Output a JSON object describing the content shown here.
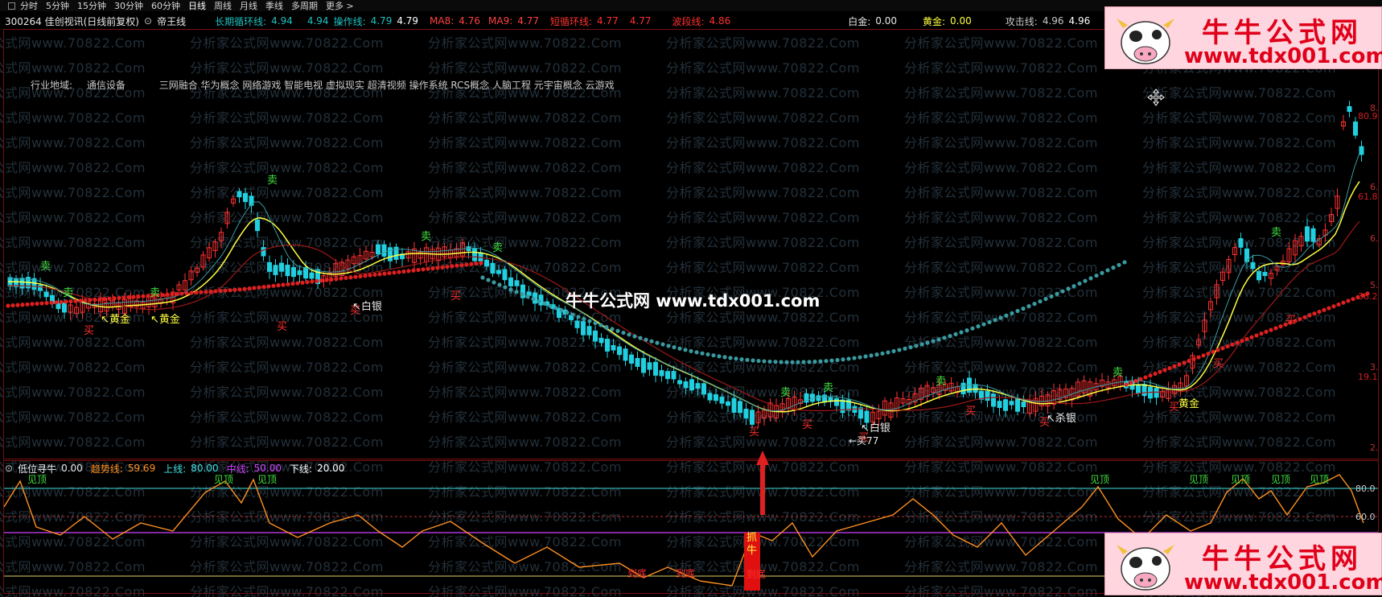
{
  "toolbar": {
    "tabs": [
      "分时",
      "5分钟",
      "15分钟",
      "30分钟",
      "60分钟",
      "日线",
      "周线",
      "月线",
      "季线",
      "多周期",
      "更多 >"
    ],
    "active_tab": "日线"
  },
  "stock": {
    "code_name": "300264 佳创视讯(日线前复权)",
    "indicator_name": "帝王线"
  },
  "main_indicators": [
    {
      "label": "长期循环线:",
      "value": "4.94",
      "color": "#20c0c0"
    },
    {
      "label": "",
      "value": "4.94",
      "color": "#20c0c0"
    },
    {
      "label": "操作线:",
      "value": "4.79",
      "color": "#20c0c0"
    },
    {
      "label": "",
      "value": "4.79",
      "color": "#ffffff"
    },
    {
      "label": "MA8:",
      "value": "4.76",
      "color": "#ff4040"
    },
    {
      "label": "MA9:",
      "value": "4.77",
      "color": "#ff4040"
    },
    {
      "label": "短循环线:",
      "value": "4.77",
      "color": "#ff3030"
    },
    {
      "label": "",
      "value": "4.77",
      "color": "#ff3030"
    },
    {
      "label": "波段线:",
      "value": "4.86",
      "color": "#ff3030"
    },
    {
      "label": "白金:",
      "value": "0.00",
      "color": "#e8e8e8"
    },
    {
      "label": "黄金:",
      "value": "0.00",
      "color": "#ffff40"
    },
    {
      "label": "攻击线:",
      "value": "4.96",
      "color": "#c8c8c8"
    },
    {
      "label": "",
      "value": "4.96",
      "color": "#ffffff"
    }
  ],
  "industry": {
    "label": "行业地域:",
    "sector": "通信设备",
    "concepts": "三网融合 华为概念 网络游戏 智能电视 虚拟现实 超清视频 操作系统 RCS概念 人脑工程 元宇宙概念 云游戏"
  },
  "watermark_text": "分析家公式网www.70822.Com",
  "center_brand": "牛牛公式网 www.tdx001.com",
  "logo": {
    "cn": "牛牛公式网",
    "url": "www.tdx001.com"
  },
  "right_axis_labels": [
    "80.9",
    "61.8",
    "38.2",
    "19.1"
  ],
  "right_axis_partial": [
    "8.",
    "6.",
    "6.",
    "5.",
    "3.",
    "2."
  ],
  "signals": {
    "sell": "卖",
    "buy": "买",
    "gold": "黄金",
    "silver": "白银",
    "kill_silver": "杀银",
    "buy77": "买77",
    "top": "见顶",
    "bottom": "到底",
    "catch": "抓牛"
  },
  "sub_indicator": {
    "name": "低位寻牛",
    "value": "0.00",
    "items": [
      {
        "label": "趋势线:",
        "value": "59.69",
        "color": "#ff9020"
      },
      {
        "label": "上线:",
        "value": "80.00",
        "color": "#40e0e0"
      },
      {
        "label": "中线:",
        "value": "50.00",
        "color": "#d040ff"
      },
      {
        "label": "下线:",
        "value": "20.00",
        "color": "#ffffff"
      }
    ],
    "axis": [
      "80.0",
      "60.0"
    ]
  },
  "colors": {
    "up": "#ff3030",
    "down": "#20d0e0",
    "ma_yellow": "#ffff40",
    "ma_dark_red": "#a01818",
    "dots_red": "#e02020",
    "dots_cyan": "#3a9aa0",
    "trend_orange": "#ff9020"
  }
}
